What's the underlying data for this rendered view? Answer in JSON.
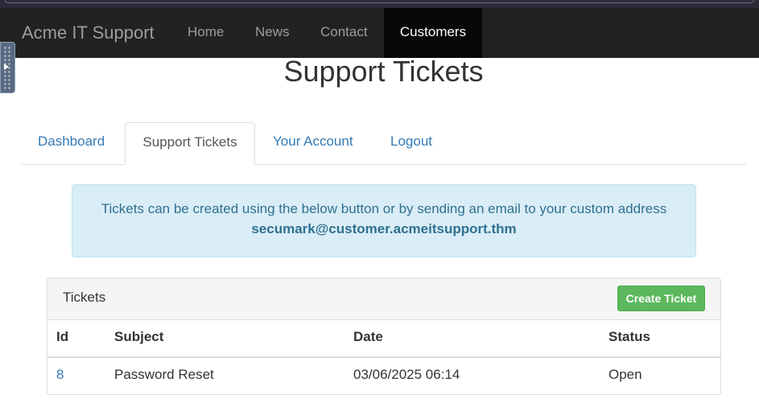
{
  "navbar": {
    "brand": "Acme IT Support",
    "items": [
      {
        "label": "Home"
      },
      {
        "label": "News"
      },
      {
        "label": "Contact"
      },
      {
        "label": "Customers",
        "active": true
      }
    ]
  },
  "page": {
    "title": "Support Tickets"
  },
  "tabs": [
    {
      "label": "Dashboard"
    },
    {
      "label": "Support Tickets",
      "active": true
    },
    {
      "label": "Your Account"
    },
    {
      "label": "Logout"
    }
  ],
  "alert": {
    "text": "Tickets can be created using the below button or by sending an email to your custom address",
    "email": "secumark@customer.acmeitsupport.thm"
  },
  "tickets_panel": {
    "title": "Tickets",
    "create_button": "Create Ticket",
    "columns": [
      "Id",
      "Subject",
      "Date",
      "Status"
    ],
    "rows": [
      {
        "id": "8",
        "subject": "Password Reset",
        "date": "03/06/2025 06:14",
        "status": "Open"
      }
    ]
  },
  "colors": {
    "navbar_bg": "#222222",
    "link": "#337ab7",
    "alert_bg": "#d9edf7",
    "success": "#5cb85c"
  }
}
